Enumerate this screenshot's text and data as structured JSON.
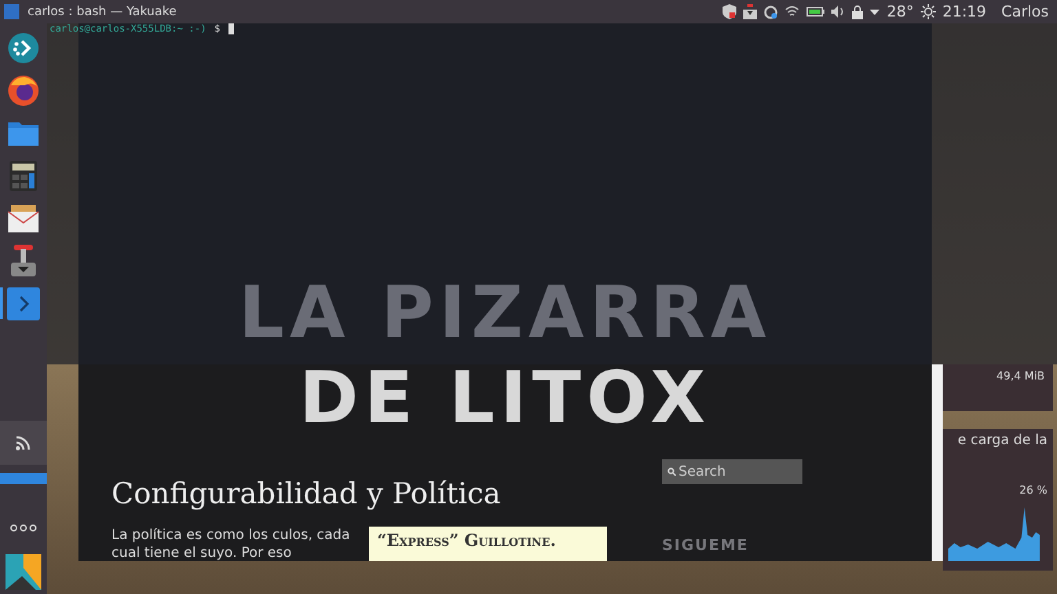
{
  "top_bar": {
    "window_title": "carlos : bash — Yakuake",
    "temperature": "28°",
    "time": "21:19",
    "user": "Carlos"
  },
  "dock": {
    "items": [
      {
        "kind": "launcher",
        "selected": false
      },
      {
        "kind": "browser",
        "selected": false
      },
      {
        "kind": "folder",
        "selected": false
      },
      {
        "kind": "calculator",
        "selected": false
      },
      {
        "kind": "mail",
        "selected": false
      },
      {
        "kind": "joystick",
        "selected": false
      },
      {
        "kind": "terminal",
        "selected": true
      }
    ],
    "bottom_items": [
      {
        "kind": "rss"
      },
      {
        "kind": "more"
      },
      {
        "kind": "tile"
      }
    ]
  },
  "terminal": {
    "prompt": "carlos@carlos-X555LDB:~ :-)",
    "symbol": "$"
  },
  "blog": {
    "logo": [
      "LA PIZARRA",
      "DE LITOX"
    ],
    "post_title": "Configurabilidad y Política",
    "paragraph": "La política es como los culos, cada cual tiene el suyo. Por eso",
    "image_caption": "“Express” Guillotine.",
    "search": {
      "placeholder": "Search"
    },
    "sidebar_heading": "SIGUEME"
  },
  "widgets": {
    "memory": "49,4 MiB",
    "cpu_title": "e carga de la",
    "cpu_reading": "26 %"
  }
}
